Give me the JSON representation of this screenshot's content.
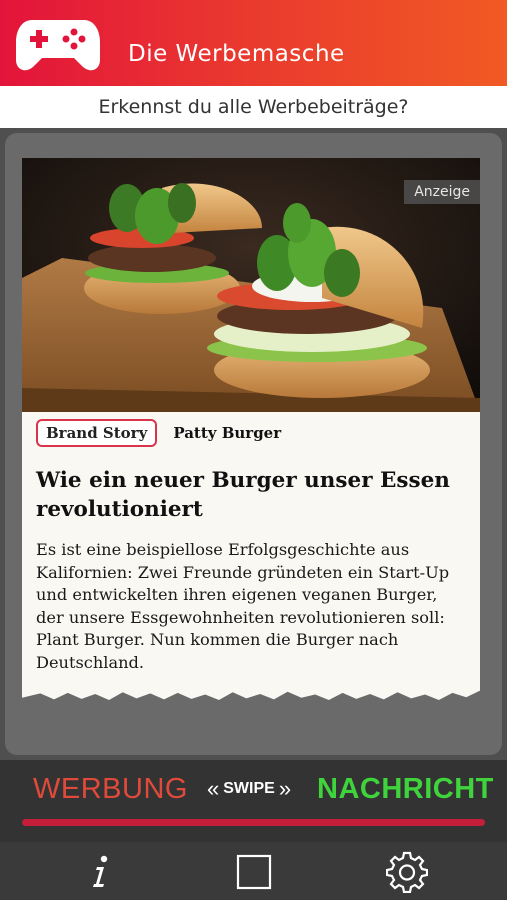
{
  "app": {
    "title": "Die Werbemasche",
    "subtitle": "Erkennst du alle Werbebeiträge?"
  },
  "card": {
    "ad_label": "Anzeige",
    "tag": "Brand Story",
    "brand": "Patty Burger",
    "headline": "Wie ein neuer Burger unser Essen revolutioniert",
    "body": "Es ist eine beispiellose Erfolgsgeschichte aus Kalifornien: Zwei Freunde gründeten ein Start-Up und entwickelten ihren eigenen veganen Burger, der unsere Essgewohnheiten revolutionieren soll: Plant Burger. Nun kommen die Burger nach Deutschland."
  },
  "swipe": {
    "left_label": "WERBUNG",
    "center_label": "SWIPE",
    "right_label": "NACHRICHT"
  },
  "nav": {
    "items": [
      "info-icon",
      "square-icon",
      "gear-icon"
    ]
  },
  "colors": {
    "header_start": "#e3143b",
    "header_end": "#f15a24",
    "werbung": "#e04a3a",
    "nachricht": "#3fd43c",
    "tag_border": "#d9354a"
  }
}
